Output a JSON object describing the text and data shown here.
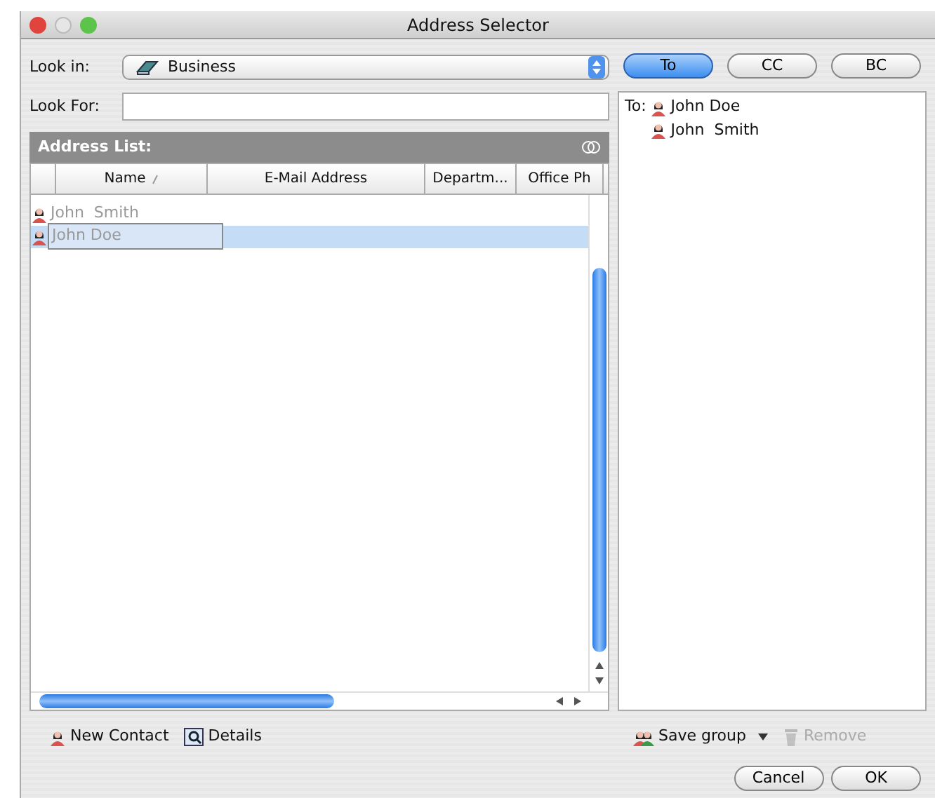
{
  "window": {
    "title": "Address Selector"
  },
  "look_in": {
    "label": "Look in:",
    "value": "Business"
  },
  "look_for": {
    "label": "Look For:"
  },
  "address_list": {
    "title": "Address List:",
    "columns": [
      {
        "label": "Name",
        "sorted": true
      },
      {
        "label": "E-Mail Address",
        "sorted": false
      },
      {
        "label": "Departm...",
        "sorted": false
      },
      {
        "label": "Office Ph",
        "sorted": false
      }
    ],
    "rows": [
      {
        "name": "John  Smith",
        "selected": false
      },
      {
        "name": "John Doe",
        "selected": true
      }
    ]
  },
  "left_actions": [
    {
      "label": "New Contact",
      "kind": "contact"
    },
    {
      "label": "Details",
      "kind": "details"
    }
  ],
  "recipient_buttons": [
    {
      "label": "To",
      "selected": true
    },
    {
      "label": "CC",
      "selected": false
    },
    {
      "label": "BC",
      "selected": false
    }
  ],
  "recipients": {
    "prefix": "To:",
    "names": [
      "John Doe",
      "John  Smith"
    ]
  },
  "right_actions": [
    {
      "label": "Save group",
      "kind": "group",
      "disabled": false
    },
    {
      "label": "Remove",
      "kind": "trash",
      "disabled": true
    }
  ],
  "buttons": [
    "Cancel",
    "OK"
  ]
}
